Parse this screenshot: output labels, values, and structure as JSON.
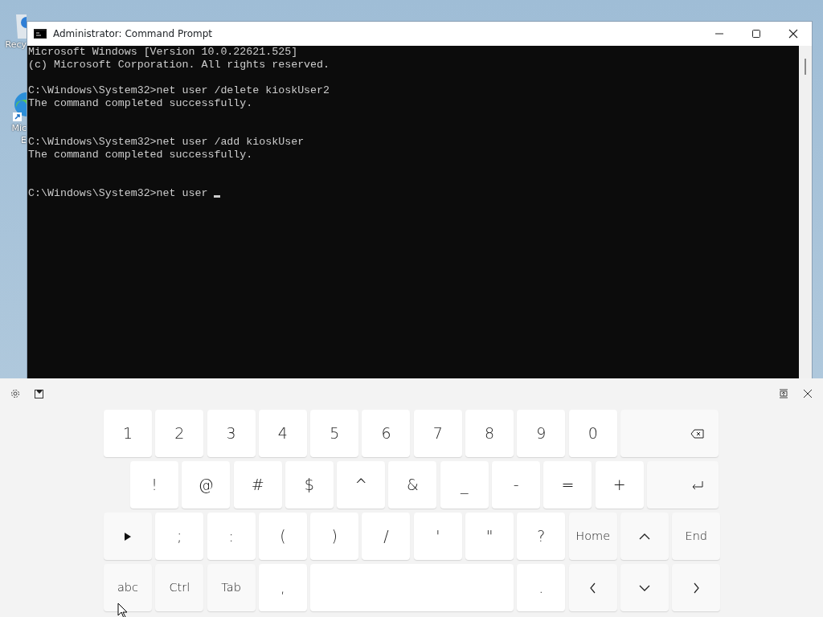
{
  "desktop_icons": [
    {
      "kind": "bin",
      "label": "Recy"
    },
    {
      "kind": "edge",
      "label": "Mic\nE"
    }
  ],
  "window": {
    "title": "Administrator: Command Prompt"
  },
  "terminal": {
    "buffer": "Microsoft Windows [Version 10.0.22621.525]\n(c) Microsoft Corporation. All rights reserved.\n\nC:\\Windows\\System32>net user /delete kioskUser2\nThe command completed successfully.\n\n\nC:\\Windows\\System32>net user /add kioskUser\nThe command completed successfully.\n\n\nC:\\Windows\\System32>net user ",
    "cursor_visible": true
  },
  "keyboard": {
    "number_keys": [
      {
        "kind": "char",
        "label": "1"
      },
      {
        "kind": "char",
        "label": "2"
      },
      {
        "kind": "char",
        "label": "3"
      },
      {
        "kind": "char",
        "label": "4"
      },
      {
        "kind": "char",
        "label": "5"
      },
      {
        "kind": "char",
        "label": "6"
      },
      {
        "kind": "char",
        "label": "7"
      },
      {
        "kind": "char",
        "label": "8"
      },
      {
        "kind": "char",
        "label": "9"
      },
      {
        "kind": "char",
        "label": "0"
      },
      {
        "kind": "backspace"
      }
    ],
    "symbol_keys": [
      {
        "kind": "char",
        "label": "!"
      },
      {
        "kind": "char",
        "label": "@"
      },
      {
        "kind": "char",
        "label": "#"
      },
      {
        "kind": "char",
        "label": "$"
      },
      {
        "kind": "char",
        "label": "^"
      },
      {
        "kind": "char",
        "label": "&"
      },
      {
        "kind": "char",
        "label": "_"
      },
      {
        "kind": "char",
        "label": "-"
      },
      {
        "kind": "char",
        "label": "="
      },
      {
        "kind": "char",
        "label": "+"
      },
      {
        "kind": "enter"
      }
    ],
    "punctuation_keys": [
      {
        "kind": "play"
      },
      {
        "kind": "char",
        "label": ";"
      },
      {
        "kind": "char",
        "label": ":"
      },
      {
        "kind": "char",
        "label": "("
      },
      {
        "kind": "char",
        "label": ")"
      },
      {
        "kind": "char",
        "label": "/"
      },
      {
        "kind": "char",
        "label": "'"
      },
      {
        "kind": "char",
        "label": "\""
      },
      {
        "kind": "char",
        "label": "?"
      },
      {
        "kind": "fn",
        "label": "Home"
      },
      {
        "kind": "up"
      },
      {
        "kind": "fn",
        "label": "End"
      }
    ],
    "bottom_keys": [
      {
        "kind": "fn",
        "label": "abc"
      },
      {
        "kind": "fn",
        "label": "Ctrl"
      },
      {
        "kind": "fn",
        "label": "Tab"
      },
      {
        "kind": "char",
        "label": ","
      },
      {
        "kind": "space"
      },
      {
        "kind": "char",
        "label": "."
      },
      {
        "kind": "left"
      },
      {
        "kind": "down"
      },
      {
        "kind": "right"
      }
    ]
  }
}
